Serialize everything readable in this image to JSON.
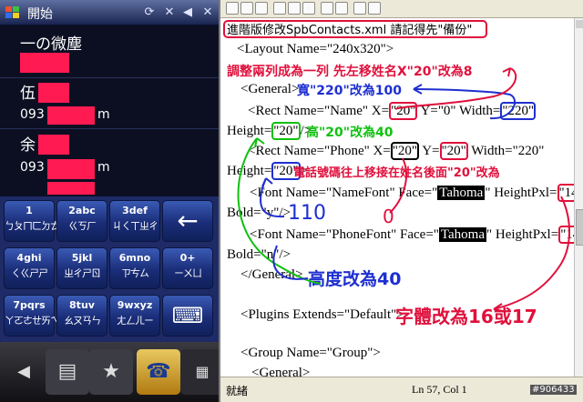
{
  "phone": {
    "title": "開始",
    "contacts": [
      {
        "name": "一の微塵",
        "phone": ""
      },
      {
        "name": "伍",
        "phone": "093",
        "suffix": "m"
      },
      {
        "name": "余",
        "phone": "093",
        "suffix": "m"
      }
    ],
    "keypad": [
      {
        "digit": "1",
        "zhuyin": "ㄅㄆㄇㄈㄉㄊㄋㄌ"
      },
      {
        "digit": "2abc",
        "zhuyin": "ㄍㄎㄏ"
      },
      {
        "digit": "3def",
        "zhuyin": "ㄐㄑㄒㄓㄔ"
      },
      {
        "digit": "4ghi",
        "zhuyin": "ㄑㄍㄕㄕ"
      },
      {
        "digit": "5jkl",
        "zhuyin": "ㄓㄔㄕㄖ"
      },
      {
        "digit": "6mno",
        "zhuyin": "ㄗㄘㄙ"
      },
      {
        "digit": "0+",
        "zhuyin": "ㄧㄨㄩ"
      },
      {
        "digit": "7pqrs",
        "zhuyin": "ㄚㄛㄜㄝㄞㄟ"
      },
      {
        "digit": "8tuv",
        "zhuyin": "ㄠㄡㄢㄣ"
      },
      {
        "digit": "9wxyz",
        "zhuyin": "ㄤㄥㄦㄧ"
      }
    ],
    "backspace_glyph": "←",
    "keyboard_glyph": "⌨",
    "colors": {
      "redaction": "#ff1a52"
    }
  },
  "editor": {
    "header_note": "進階版修改SpbContacts.xml 請記得先\"備份\"",
    "lines": {
      "layout": "<Layout Name=\"240x320\">",
      "general": "<General>",
      "rect_name_a": "<Rect Name=\"Name\" X=",
      "rect_name_x": "\"20\"",
      "rect_name_b": " Y=\"0\" Width=",
      "rect_name_w": "\"220\"",
      "height_a": "Height=",
      "height_v": "\"20\"",
      "height_b": "/>",
      "rect_phone_a": "<Rect Name=\"Phone\" X=",
      "rect_phone_x": "\"20\"",
      "rect_phone_b": " Y=",
      "rect_phone_y": "\"20\"",
      "rect_phone_c": " Width=\"220\"",
      "height2_a": "Height=",
      "height2_v": "\"20\"",
      "height2_b": ">",
      "font1_a": "<Font Name=\"NameFont\" Face=\"",
      "font1_face": "Tahoma",
      "font1_b": "\" HeightPxl=",
      "font1_v": "\"14\"",
      "bold1": "Bold=\"y\"/>",
      "font2_a": "<Font Name=\"PhoneFont\" Face=\"",
      "font2_face": "Tahoma",
      "font2_b": "\" HeightPxl=",
      "font2_v": "\"14\"",
      "bold2": "Bold=\"n\"/>",
      "general_end": "</General>",
      "plugins": "<Plugins Extends=\"Default\">",
      "group": "<Group Name=\"Group\">",
      "general2": "<General>"
    },
    "annotations": {
      "merge_rows": "調整兩列成為一列 先左移姓名X\"20\"改為8",
      "width": "寬\"220\"改為100",
      "height": "高\"20\"改為40",
      "phone_move": "電話號碼往上移接在姓名後面\"20\"改為",
      "val_110": "110",
      "val_0": "0",
      "height_change": "高度改為40",
      "font_change": "字體改為16或17"
    },
    "status": {
      "ready": "就緒",
      "position": "Ln 57, Col 1"
    },
    "watermark": "#906433",
    "colors": {
      "red": "#e0103c",
      "blue": "#1e2fd0",
      "green": "#10c010"
    }
  }
}
